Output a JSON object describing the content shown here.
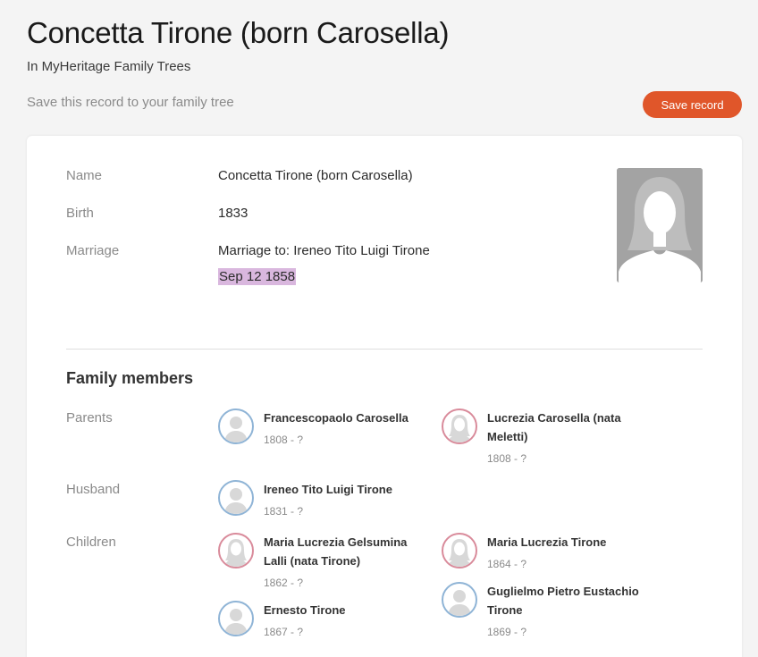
{
  "header": {
    "title": "Concetta Tirone (born Carosella)",
    "subtitle": "In MyHeritage Family Trees",
    "save_hint": "Save this record to your family tree",
    "save_button": "Save record"
  },
  "colors": {
    "accent": "#e0562a",
    "highlight": "#d9b7de",
    "male_ring": "#8fb4d6",
    "female_ring": "#d98b9b"
  },
  "record": {
    "name_label": "Name",
    "name_value": "Concetta Tirone (born Carosella)",
    "birth_label": "Birth",
    "birth_value": "1833",
    "marriage_label": "Marriage",
    "marriage_value": "Marriage to: Ireneo Tito Luigi Tirone",
    "marriage_date": "Sep 12 1858",
    "photo_icon": "female-silhouette-icon"
  },
  "family": {
    "title": "Family members",
    "parents_label": "Parents",
    "husband_label": "Husband",
    "children_label": "Children",
    "parents": [
      {
        "name": "Francescopaolo Carosella",
        "years": "1808 - ?",
        "gender": "male"
      },
      {
        "name": "Lucrezia Carosella (nata Meletti)",
        "years": "1808 - ?",
        "gender": "female"
      }
    ],
    "husband": [
      {
        "name": "Ireneo Tito Luigi Tirone",
        "years": "1831 - ?",
        "gender": "male"
      }
    ],
    "children": [
      {
        "name": "Maria Lucrezia Gelsumina Lalli (nata Tirone)",
        "years": "1862 - ?",
        "gender": "female"
      },
      {
        "name": "Maria Lucrezia Tirone",
        "years": "1864 - ?",
        "gender": "female"
      },
      {
        "name": "Ernesto Tirone",
        "years": "1867 - ?",
        "gender": "male"
      },
      {
        "name": "Guglielmo Pietro Eustachio Tirone",
        "years": "1869 - ?",
        "gender": "male"
      }
    ]
  }
}
